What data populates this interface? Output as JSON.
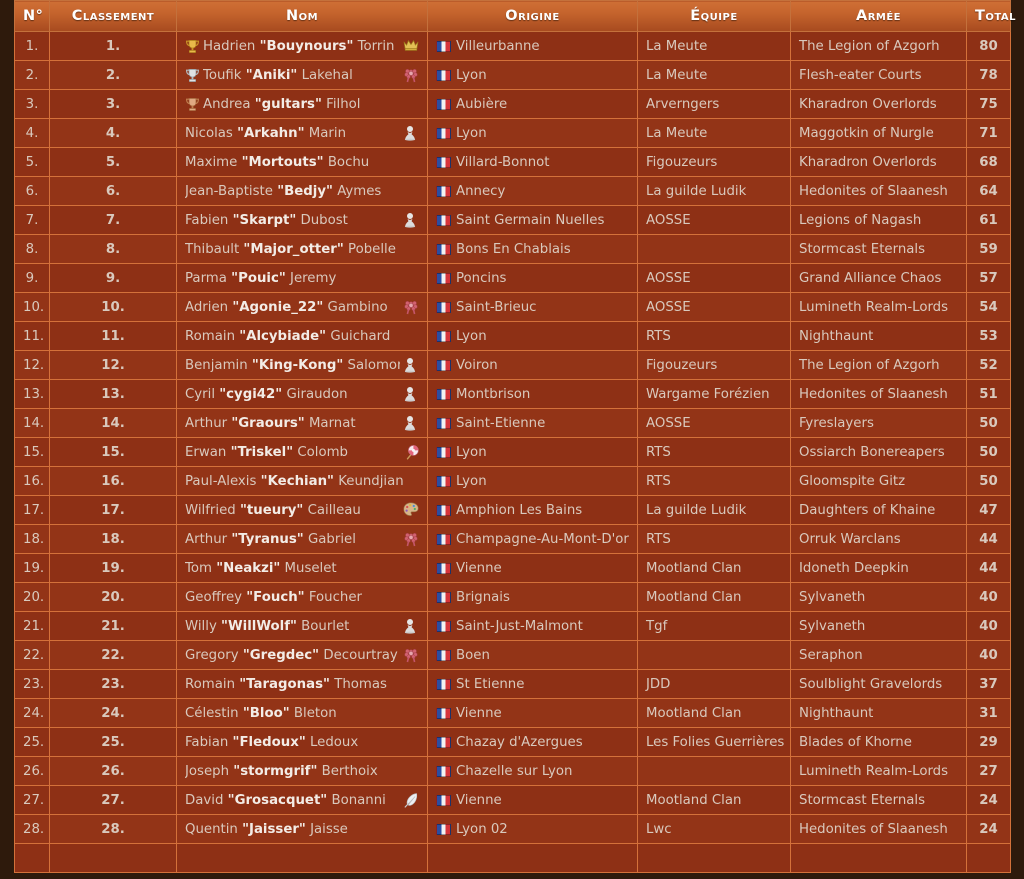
{
  "table": {
    "columns": [
      {
        "key": "num",
        "label": "N°"
      },
      {
        "key": "rank",
        "label": "Classement"
      },
      {
        "key": "name",
        "label": "Nom"
      },
      {
        "key": "origin",
        "label": "Origine"
      },
      {
        "key": "team",
        "label": "Équipe"
      },
      {
        "key": "army",
        "label": "Armée"
      },
      {
        "key": "total",
        "label": "Total"
      }
    ],
    "colors": {
      "page_background": "#2e1a0c",
      "row_background": "#8e3015",
      "row_background_alt": "#933417",
      "border": "#d4713a",
      "header_top": "#cf6f35",
      "header_bottom": "#a74a1f",
      "text": "#d9c9bd",
      "text_strong": "#f3ece6"
    },
    "flag_icon": "french-flag-icon",
    "rows": [
      {
        "num": "1.",
        "rank": "1.",
        "first": "Hadrien",
        "nick": "\"Bouynours\"",
        "last": "Torrin",
        "trophy": "gold-trophy-icon",
        "badge": "crown-icon",
        "origin": "Villeurbanne",
        "team": "La Meute",
        "army": "The Legion of Azgorh",
        "total": "80"
      },
      {
        "num": "2.",
        "rank": "2.",
        "first": "Toufik",
        "nick": "\"Aniki\"",
        "last": "Lakehal",
        "trophy": "silver-trophy-icon",
        "badge": "rosette-icon",
        "origin": "Lyon",
        "team": "La Meute",
        "army": "Flesh-eater Courts",
        "total": "78"
      },
      {
        "num": "3.",
        "rank": "3.",
        "first": "Andrea",
        "nick": "\"gultars\"",
        "last": "Filhol",
        "trophy": "bronze-trophy-icon",
        "badge": "",
        "origin": "Aubière",
        "team": "Arverngers",
        "army": "Kharadron Overlords",
        "total": "75"
      },
      {
        "num": "4.",
        "rank": "4.",
        "first": "Nicolas",
        "nick": "\"Arkahn\"",
        "last": "Marin",
        "trophy": "",
        "badge": "pawn-icon",
        "origin": "Lyon",
        "team": "La Meute",
        "army": "Maggotkin of Nurgle",
        "total": "71"
      },
      {
        "num": "5.",
        "rank": "5.",
        "first": "Maxime",
        "nick": "\"Mortouts\"",
        "last": "Bochu",
        "trophy": "",
        "badge": "",
        "origin": "Villard-Bonnot",
        "team": "Figouzeurs",
        "army": "Kharadron Overlords",
        "total": "68"
      },
      {
        "num": "6.",
        "rank": "6.",
        "first": "Jean-Baptiste",
        "nick": "\"Bedjy\"",
        "last": "Aymes",
        "trophy": "",
        "badge": "",
        "origin": "Annecy",
        "team": "La guilde Ludik",
        "army": "Hedonites of Slaanesh",
        "total": "64"
      },
      {
        "num": "7.",
        "rank": "7.",
        "first": "Fabien",
        "nick": "\"Skarpt\"",
        "last": "Dubost",
        "trophy": "",
        "badge": "pawn-icon",
        "origin": "Saint Germain Nuelles",
        "team": "AOSSE",
        "army": "Legions of Nagash",
        "total": "61"
      },
      {
        "num": "8.",
        "rank": "8.",
        "first": "Thibault",
        "nick": "\"Major_otter\"",
        "last": "Pobelle",
        "trophy": "",
        "badge": "",
        "origin": "Bons En Chablais",
        "team": "",
        "army": "Stormcast Eternals",
        "total": "59"
      },
      {
        "num": "9.",
        "rank": "9.",
        "first": "Parma",
        "nick": "\"Pouic\"",
        "last": "Jeremy",
        "trophy": "",
        "badge": "",
        "origin": "Poncins",
        "team": "AOSSE",
        "army": "Grand Alliance Chaos",
        "total": "57"
      },
      {
        "num": "10.",
        "rank": "10.",
        "first": "Adrien",
        "nick": "\"Agonie_22\"",
        "last": "Gambino",
        "trophy": "",
        "badge": "rosette-icon",
        "origin": "Saint-Brieuc",
        "team": "AOSSE",
        "army": "Lumineth Realm-Lords",
        "total": "54"
      },
      {
        "num": "11.",
        "rank": "11.",
        "first": "Romain",
        "nick": "\"Alcybiade\"",
        "last": "Guichard",
        "trophy": "",
        "badge": "",
        "origin": "Lyon",
        "team": "RTS",
        "army": "Nighthaunt",
        "total": "53"
      },
      {
        "num": "12.",
        "rank": "12.",
        "first": "Benjamin",
        "nick": "\"King-Kong\"",
        "last": "Salomon",
        "trophy": "",
        "badge": "pawn-icon",
        "origin": "Voiron",
        "team": "Figouzeurs",
        "army": "The Legion of Azgorh",
        "total": "52"
      },
      {
        "num": "13.",
        "rank": "13.",
        "first": "Cyril",
        "nick": "\"cygi42\"",
        "last": "Giraudon",
        "trophy": "",
        "badge": "pawn-icon",
        "origin": "Montbrison",
        "team": "Wargame Forézien",
        "army": "Hedonites of Slaanesh",
        "total": "51"
      },
      {
        "num": "14.",
        "rank": "14.",
        "first": "Arthur",
        "nick": "\"Graours\"",
        "last": "Marnat",
        "trophy": "",
        "badge": "pawn-icon",
        "origin": "Saint-Etienne",
        "team": "AOSSE",
        "army": "Fyreslayers",
        "total": "50"
      },
      {
        "num": "15.",
        "rank": "15.",
        "first": "Erwan",
        "nick": "\"Triskel\"",
        "last": "Colomb",
        "trophy": "",
        "badge": "lollipop-icon",
        "origin": "Lyon",
        "team": "RTS",
        "army": "Ossiarch Bonereapers",
        "total": "50"
      },
      {
        "num": "16.",
        "rank": "16.",
        "first": "Paul-Alexis",
        "nick": "\"Kechian\"",
        "last": "Keundjian",
        "trophy": "",
        "badge": "",
        "origin": "Lyon",
        "team": "RTS",
        "army": "Gloomspite Gitz",
        "total": "50"
      },
      {
        "num": "17.",
        "rank": "17.",
        "first": "Wilfried",
        "nick": "\"tueury\"",
        "last": "Cailleau",
        "trophy": "",
        "badge": "palette-icon",
        "origin": "Amphion Les Bains",
        "team": "La guilde Ludik",
        "army": "Daughters of Khaine",
        "total": "47"
      },
      {
        "num": "18.",
        "rank": "18.",
        "first": "Arthur",
        "nick": "\"Tyranus\"",
        "last": "Gabriel",
        "trophy": "",
        "badge": "rosette-icon",
        "origin": "Champagne-Au-Mont-D'or",
        "team": "RTS",
        "army": "Orruk Warclans",
        "total": "44"
      },
      {
        "num": "19.",
        "rank": "19.",
        "first": "Tom",
        "nick": "\"Neakzi\"",
        "last": "Muselet",
        "trophy": "",
        "badge": "",
        "origin": "Vienne",
        "team": "Mootland Clan",
        "army": "Idoneth Deepkin",
        "total": "44"
      },
      {
        "num": "20.",
        "rank": "20.",
        "first": "Geoffrey",
        "nick": "\"Fouch\"",
        "last": "Foucher",
        "trophy": "",
        "badge": "",
        "origin": "Brignais",
        "team": "Mootland Clan",
        "army": "Sylvaneth",
        "total": "40"
      },
      {
        "num": "21.",
        "rank": "21.",
        "first": "Willy",
        "nick": "\"WillWolf\"",
        "last": "Bourlet",
        "trophy": "",
        "badge": "pawn-icon",
        "origin": "Saint-Just-Malmont",
        "team": "Tgf",
        "army": "Sylvaneth",
        "total": "40"
      },
      {
        "num": "22.",
        "rank": "22.",
        "first": "Gregory",
        "nick": "\"Gregdec\"",
        "last": "Decourtray",
        "trophy": "",
        "badge": "rosette-icon",
        "origin": "Boen",
        "team": "",
        "army": "Seraphon",
        "total": "40"
      },
      {
        "num": "23.",
        "rank": "23.",
        "first": "Romain",
        "nick": "\"Taragonas\"",
        "last": "Thomas",
        "trophy": "",
        "badge": "",
        "origin": "St Etienne",
        "team": "JDD",
        "army": "Soulblight Gravelords",
        "total": "37"
      },
      {
        "num": "24.",
        "rank": "24.",
        "first": "Célestin",
        "nick": "\"Bloo\"",
        "last": "Bleton",
        "trophy": "",
        "badge": "",
        "origin": "Vienne",
        "team": "Mootland Clan",
        "army": "Nighthaunt",
        "total": "31"
      },
      {
        "num": "25.",
        "rank": "25.",
        "first": "Fabian",
        "nick": "\"Fledoux\"",
        "last": "Ledoux",
        "trophy": "",
        "badge": "",
        "origin": "Chazay d'Azergues",
        "team": "Les Folies Guerrières",
        "army": "Blades of Khorne",
        "total": "29"
      },
      {
        "num": "26.",
        "rank": "26.",
        "first": "Joseph",
        "nick": "\"stormgrif\"",
        "last": "Berthoix",
        "trophy": "",
        "badge": "",
        "origin": "Chazelle sur Lyon",
        "team": "",
        "army": "Lumineth Realm-Lords",
        "total": "27"
      },
      {
        "num": "27.",
        "rank": "27.",
        "first": "David",
        "nick": "\"Grosacquet\"",
        "last": "Bonanni",
        "trophy": "",
        "badge": "feather-icon",
        "origin": "Vienne",
        "team": "Mootland Clan",
        "army": "Stormcast Eternals",
        "total": "24"
      },
      {
        "num": "28.",
        "rank": "28.",
        "first": "Quentin",
        "nick": "\"Jaisser\"",
        "last": "Jaisse",
        "trophy": "",
        "badge": "",
        "origin": "Lyon 02",
        "team": "Lwc",
        "army": "Hedonites of Slaanesh",
        "total": "24"
      }
    ]
  }
}
